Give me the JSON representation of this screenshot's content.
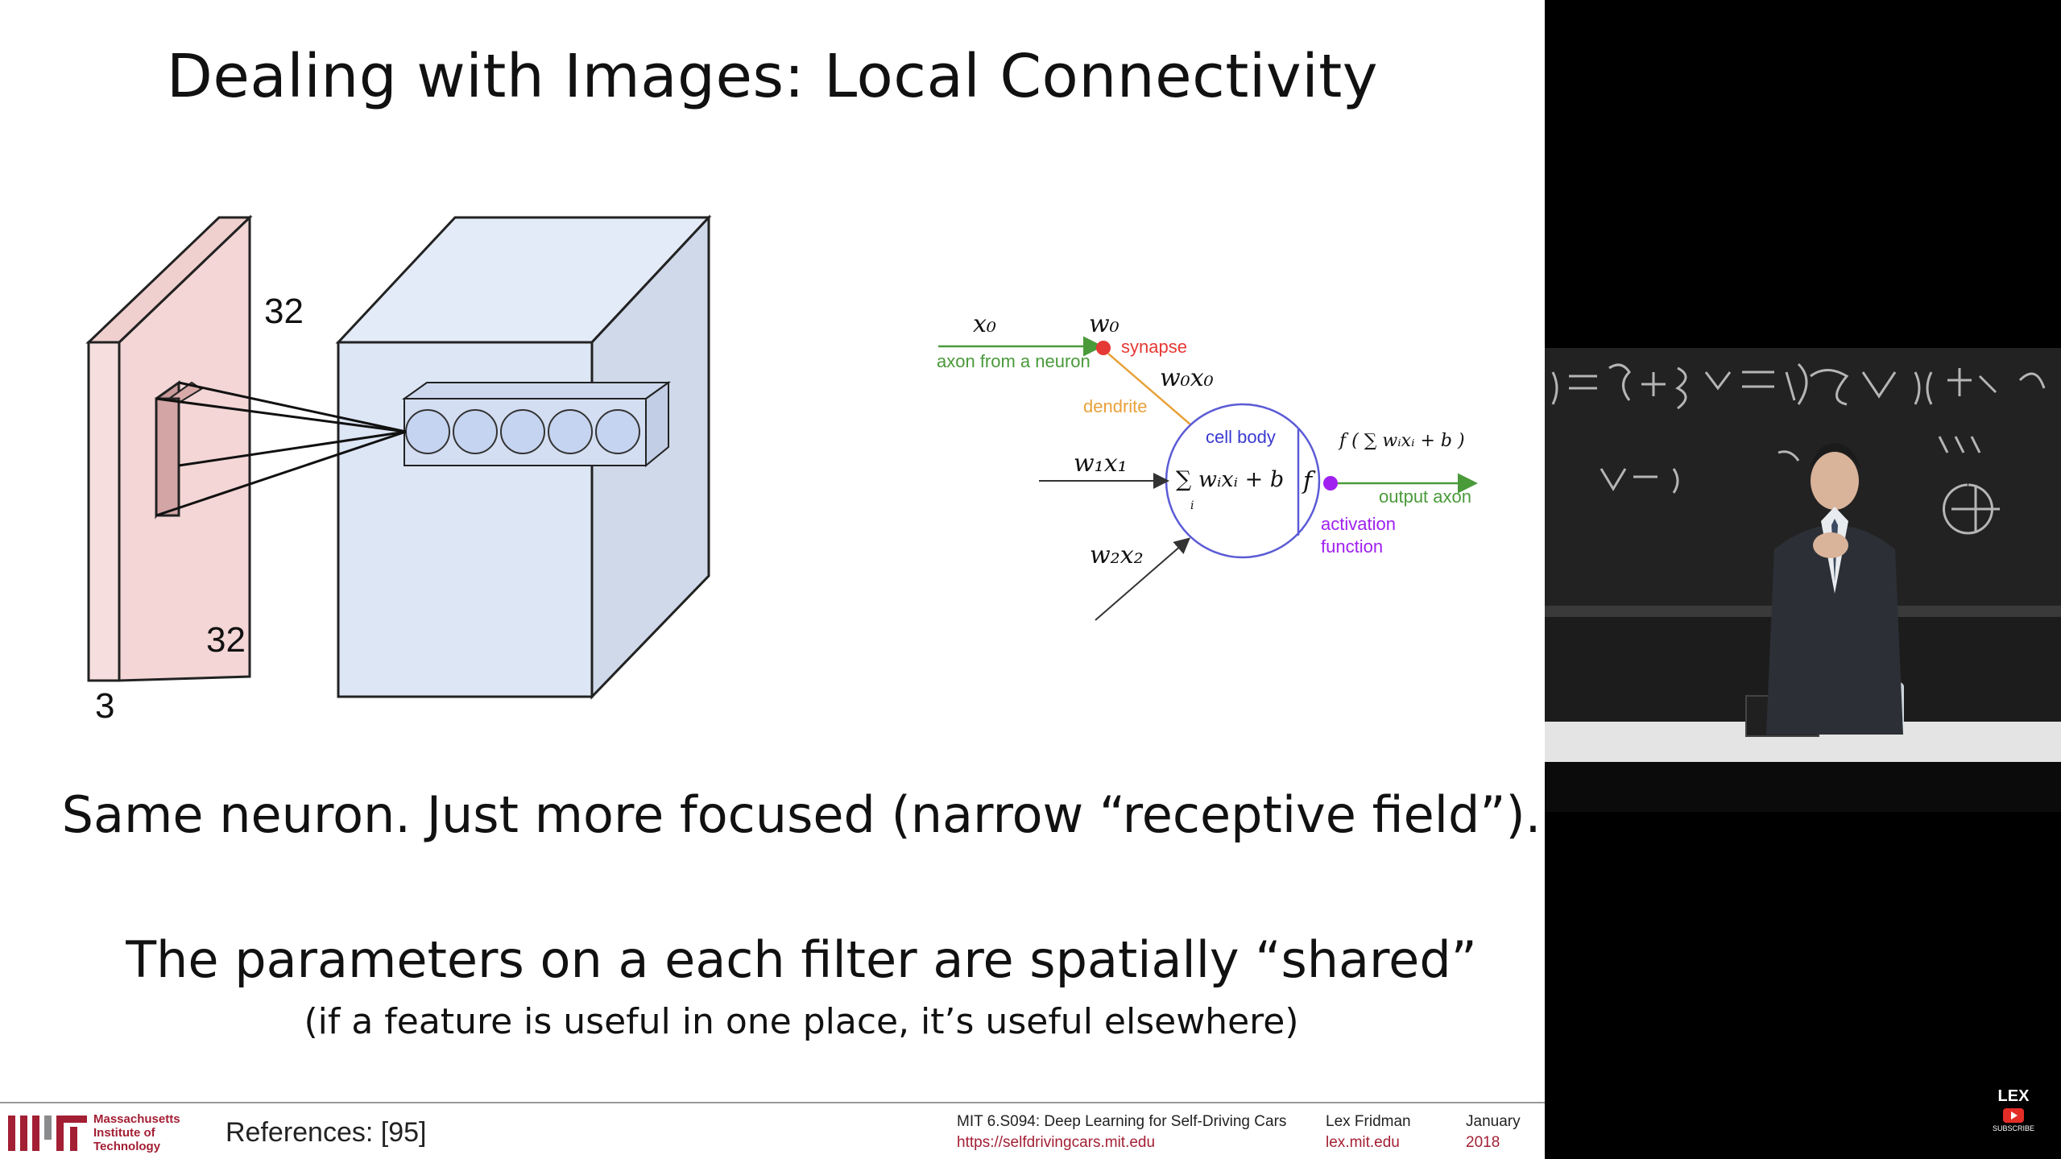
{
  "slide": {
    "title": "Dealing with Images: Local Connectivity",
    "volume_dims": {
      "height": "32",
      "width": "32",
      "depth": "3"
    },
    "neuron_diagram": {
      "x0": "x₀",
      "w0": "w₀",
      "synapse": "synapse",
      "axon_from_neuron": "axon from a neuron",
      "w0x0": "w₀x₀",
      "dendrite": "dendrite",
      "cell_body": "cell body",
      "w1x1": "w₁x₁",
      "sum_expr": "∑ wᵢxᵢ + b",
      "sum_index": "i",
      "f": "f",
      "f_output": "f ( ∑ wᵢxᵢ + b )",
      "output_axon": "output axon",
      "activation": "activation",
      "function": "function",
      "w2x2": "w₂x₂"
    },
    "statement": "Same neuron. Just more focused (narrow “receptive field”).",
    "shared": "The parameters on a each filter are spatially “shared”",
    "shared_note": "(if a feature is useful in one place, it’s useful elsewhere)"
  },
  "footer": {
    "institution": [
      "Massachusetts",
      "Institute of",
      "Technology"
    ],
    "references": "References: [95]",
    "course": "MIT 6.S094: Deep Learning for Self-Driving Cars",
    "course_url": "https://selfdrivingcars.mit.edu",
    "author": "Lex Fridman",
    "author_url": "lex.mit.edu",
    "month": "January",
    "year": "2018"
  },
  "channel": {
    "name": "LEX",
    "subscribe": "SUBSCRIBE"
  },
  "colors": {
    "brand": "#a31f34",
    "slab_fill": "#f3dcdc",
    "cube_fill": "#dde6f5",
    "neuron_circle": "#5b5bd6",
    "synapse": "#e53935",
    "activation": "#a020f0",
    "axon_green": "#4a9a3a",
    "dendrite": "#e8a13a"
  }
}
